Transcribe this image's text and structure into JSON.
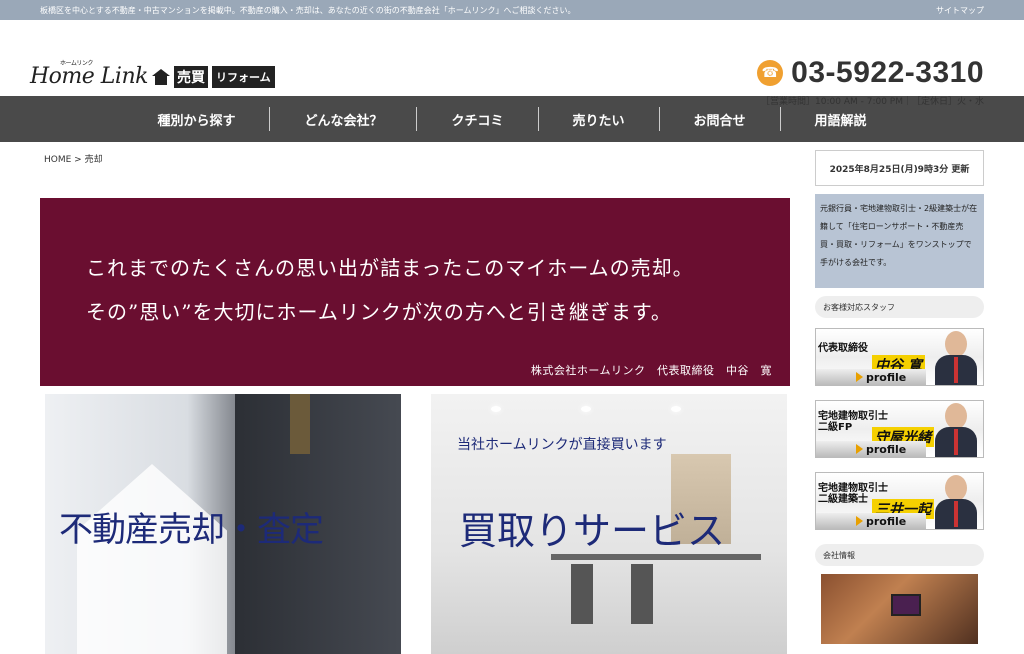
{
  "topbar": {
    "notice": "板橋区を中心とする不動産・中古マンションを掲載中。不動産の購入・売却は、あなたの近くの街の不動産会社「ホームリンク」へご相談ください。",
    "sitemap": "サイトマップ"
  },
  "logo": {
    "script": "Home Link",
    "kana": "ホームリンク",
    "baibai": "売買",
    "reform": "リフォーム"
  },
  "contact": {
    "phone": "03-5922-3310",
    "hours": "［営業時間］10:00 AM - 7:00 PM｜［定休日］火・水"
  },
  "nav": {
    "items": [
      {
        "label": "種別から探す"
      },
      {
        "label": "どんな会社？"
      },
      {
        "label": "クチコミ"
      },
      {
        "label": "売りたい"
      },
      {
        "label": "お問合せ"
      },
      {
        "label": "用語解説"
      }
    ]
  },
  "breadcrumb": "HOME > 売却",
  "banner": {
    "line1": "これまでのたくさんの思い出が詰まったこのマイホームの売却。",
    "line2": "その”思い”を大切にホームリンクが次の方へと引き継ぎます。",
    "signature": "株式会社ホームリンク　代表取締役　中谷　寛"
  },
  "cards": {
    "sell": {
      "title": "不動産売却・査定"
    },
    "buy": {
      "subtitle": "当社ホームリンクが直接買います",
      "title": "買取りサービス"
    }
  },
  "sidebar": {
    "updated": "2025年8月25日(月)9時3分 更新",
    "intro": "元銀行員・宅地建物取引士・2級建築士が在籍して「住宅ローンサポート・不動産売買・買取・リフォーム」をワンストップで手がける会社です。",
    "staff_heading": "お客様対応スタッフ",
    "staff": [
      {
        "role": "代表取締役",
        "name": "中谷 寛",
        "link": "profile"
      },
      {
        "role": "宅地建物取引士\n二級FP",
        "name": "守屋光緒",
        "link": "profile"
      },
      {
        "role": "宅地建物取引士\n二級建築士",
        "name": "三井一起",
        "link": "profile"
      }
    ],
    "company_heading": "会社情報"
  },
  "colors": {
    "banner_bg": "#6a0e30",
    "nav_bg": "#4a4a4a",
    "topbar_bg": "#9aa8b8",
    "accent_phone": "#f0a030",
    "title_blue": "#1d2a78"
  }
}
